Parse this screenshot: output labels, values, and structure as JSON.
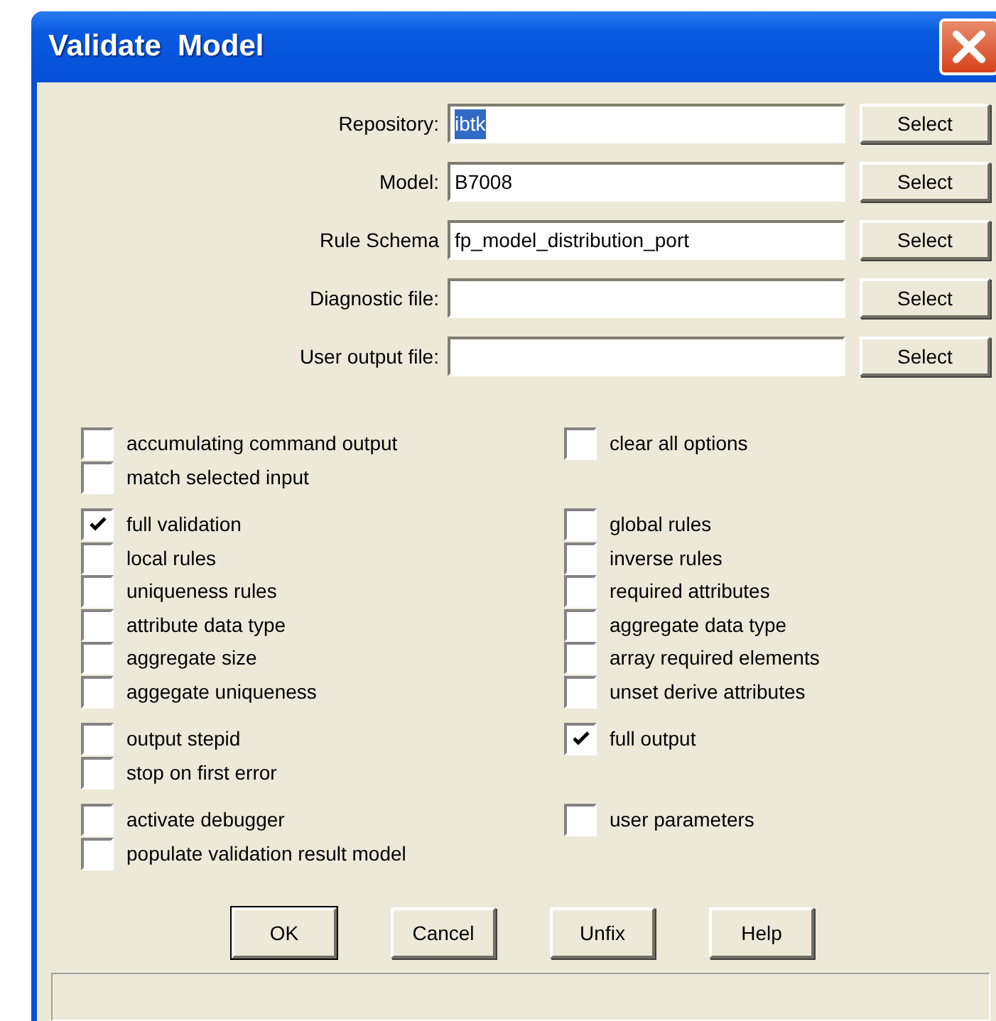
{
  "window": {
    "title": "Validate  Model"
  },
  "fields": [
    {
      "label": "Repository:",
      "value": "ibtk",
      "selected": true,
      "button": "Select"
    },
    {
      "label": "Model:",
      "value": "B7008",
      "selected": false,
      "button": "Select"
    },
    {
      "label": "Rule Schema",
      "value": "fp_model_distribution_port",
      "selected": false,
      "button": "Select"
    },
    {
      "label": "Diagnostic file:",
      "button": "Select"
    },
    {
      "label": "User output file:",
      "button": "Select"
    }
  ],
  "option_groups": [
    {
      "left": [
        {
          "label": "accumulating command output",
          "checked": false
        },
        {
          "label": "match selected input",
          "checked": false
        }
      ],
      "right": [
        {
          "label": "clear all options",
          "checked": false
        }
      ]
    },
    {
      "left": [
        {
          "label": "full validation",
          "checked": true
        },
        {
          "label": "local rules",
          "checked": false
        },
        {
          "label": "uniqueness rules",
          "checked": false
        },
        {
          "label": "attribute data type",
          "checked": false
        },
        {
          "label": "aggregate size",
          "checked": false
        },
        {
          "label": "aggegate uniqueness",
          "checked": false
        }
      ],
      "right": [
        {
          "label": "global rules",
          "checked": false
        },
        {
          "label": "inverse rules",
          "checked": false
        },
        {
          "label": "required attributes",
          "checked": false
        },
        {
          "label": "aggregate data type",
          "checked": false
        },
        {
          "label": "array required elements",
          "checked": false
        },
        {
          "label": "unset derive attributes",
          "checked": false
        }
      ]
    },
    {
      "left": [
        {
          "label": "output stepid",
          "checked": false
        },
        {
          "label": "stop on first error",
          "checked": false
        }
      ],
      "right": [
        {
          "label": "full output",
          "checked": true
        }
      ]
    },
    {
      "left": [
        {
          "label": "activate debugger",
          "checked": false
        },
        {
          "label": "populate validation result model",
          "checked": false
        }
      ],
      "right": [
        {
          "label": "user parameters",
          "checked": false
        }
      ]
    }
  ],
  "buttons": [
    {
      "label": "OK",
      "default": true
    },
    {
      "label": "Cancel",
      "default": false
    },
    {
      "label": "Unfix",
      "default": false
    },
    {
      "label": "Help",
      "default": false
    }
  ]
}
